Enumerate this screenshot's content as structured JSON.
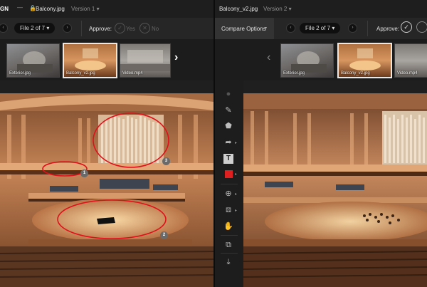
{
  "left": {
    "brand": "GN",
    "file_name": "Balcony.jpg",
    "version": "Version 1",
    "file_counter": "File 2 of 7",
    "approve_label": "Approve:",
    "yes_label": "Yes",
    "no_label": "No",
    "thumbs": [
      "Exterior.jpg",
      "Balcony_v2.jpg",
      "Video.mp4"
    ],
    "markers": [
      "1",
      "2",
      "3"
    ]
  },
  "right": {
    "file_name": "Balcony_v2.jpg",
    "version": "Version 2",
    "compare_label": "Compare Options",
    "file_counter": "File 2 of 7",
    "approve_label": "Approve:",
    "thumbs": [
      "Exterior.jpg",
      "Balcony_v2.jpg",
      "Video.mp4"
    ]
  },
  "tools": [
    "pointer-icon",
    "pen-icon",
    "shape-icon",
    "arrow-icon",
    "text-icon",
    "color-swatch",
    "zoom-icon",
    "grid-icon",
    "hand-icon",
    "layers-icon",
    "download-icon"
  ],
  "colors": {
    "annotation": "#e0101a",
    "swatch": "#e02020"
  }
}
